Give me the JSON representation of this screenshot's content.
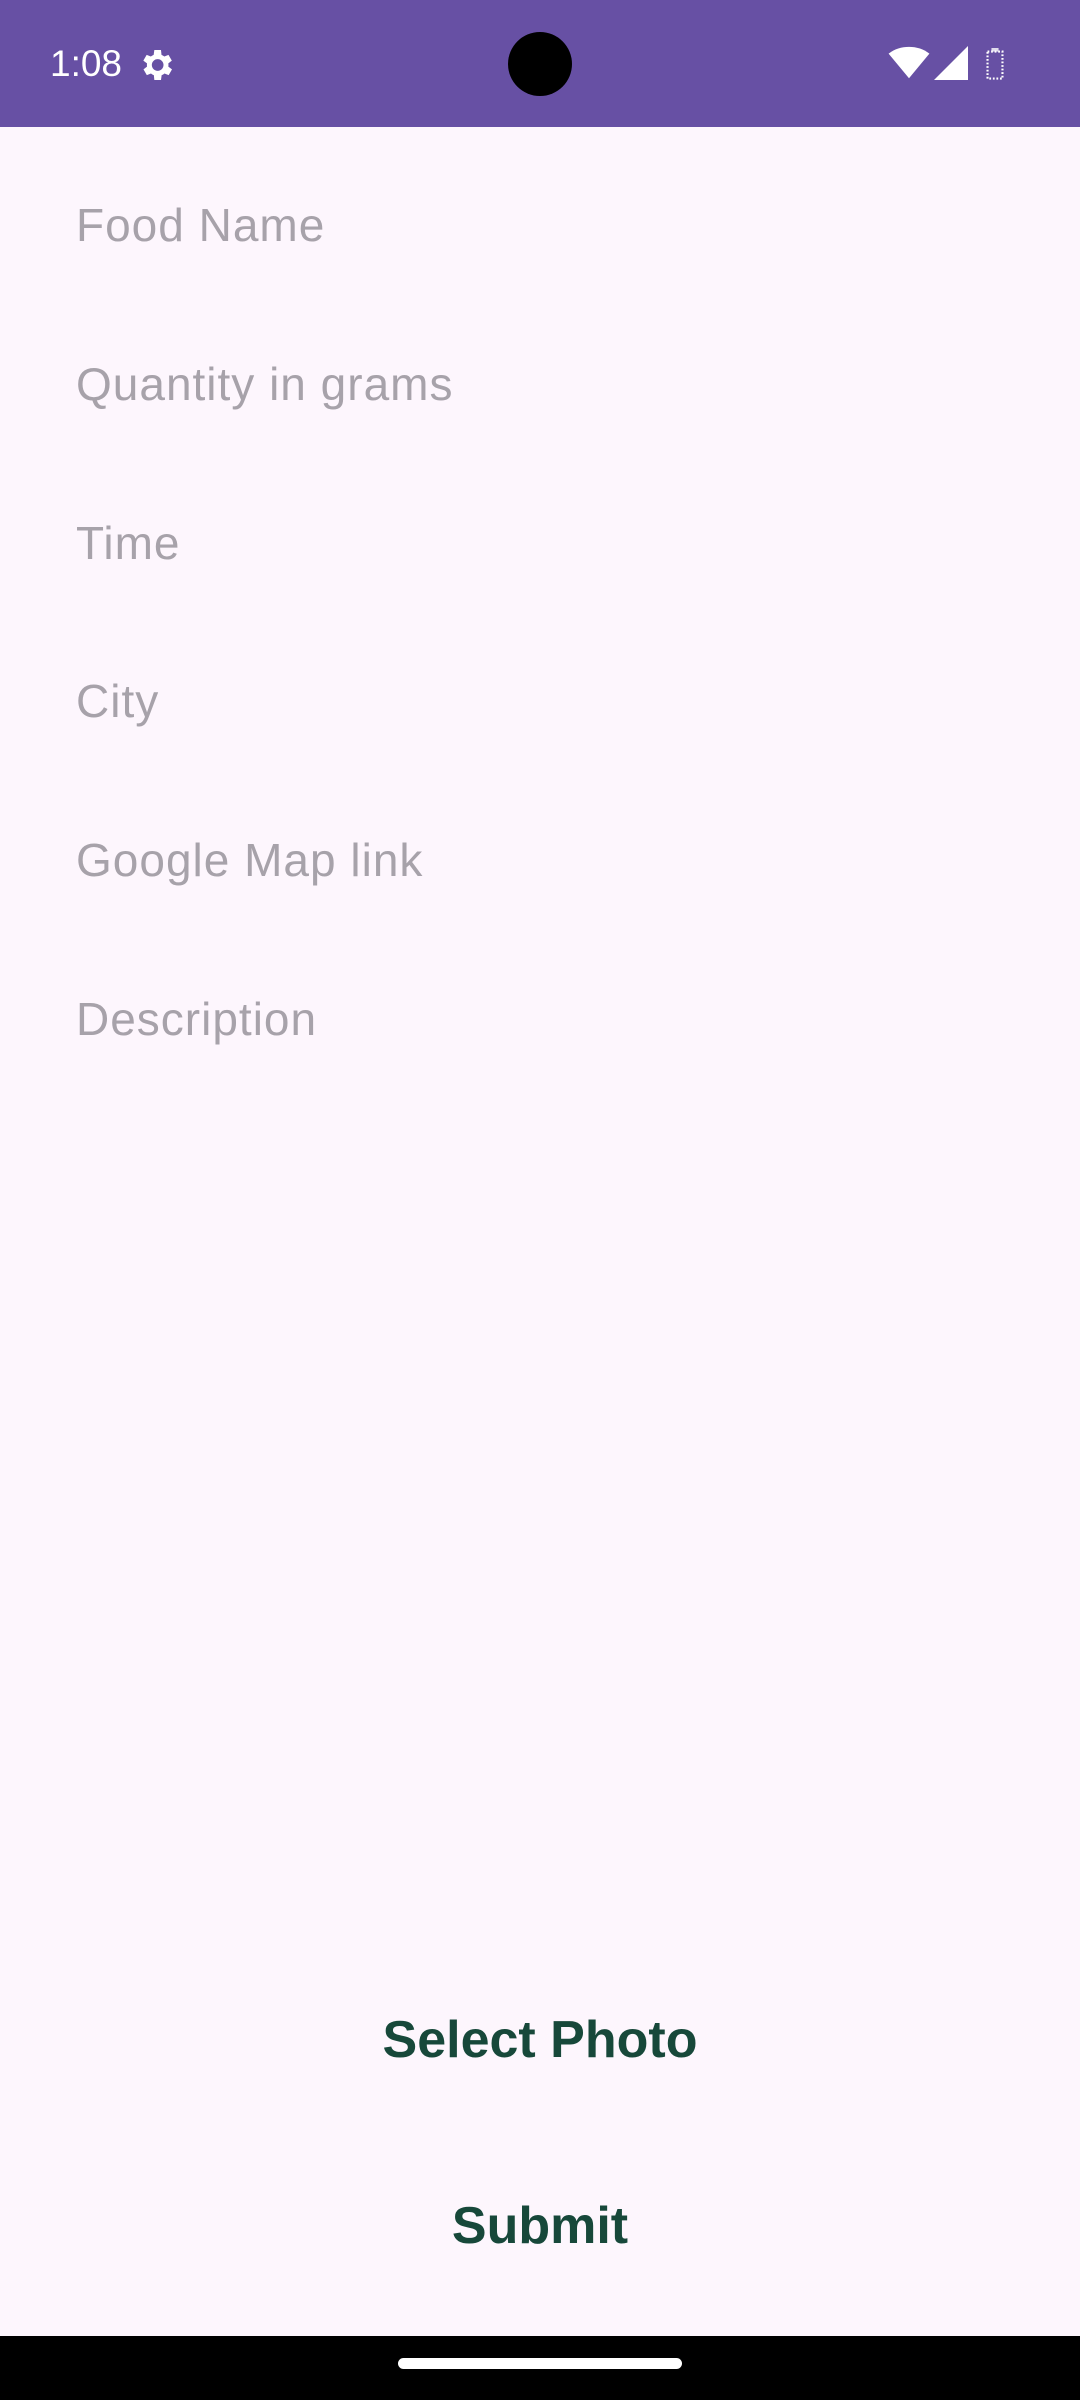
{
  "status_bar": {
    "time": "1:08",
    "background_color": "#6750a4",
    "icons": [
      "gear-icon",
      "wifi-icon",
      "signal-icon",
      "battery-icon"
    ]
  },
  "form": {
    "fields": [
      {
        "placeholder": "Food Name",
        "value": ""
      },
      {
        "placeholder": "Quantity in grams",
        "value": ""
      },
      {
        "placeholder": "Time",
        "value": ""
      },
      {
        "placeholder": "City",
        "value": ""
      },
      {
        "placeholder": "Google Map link",
        "value": ""
      },
      {
        "placeholder": "Description",
        "value": ""
      }
    ]
  },
  "actions": {
    "select_photo_label": "Select Photo",
    "submit_label": "Submit",
    "button_text_color": "#17483a"
  },
  "colors": {
    "background": "#fdf6fd",
    "placeholder": "#a7a2aa"
  }
}
